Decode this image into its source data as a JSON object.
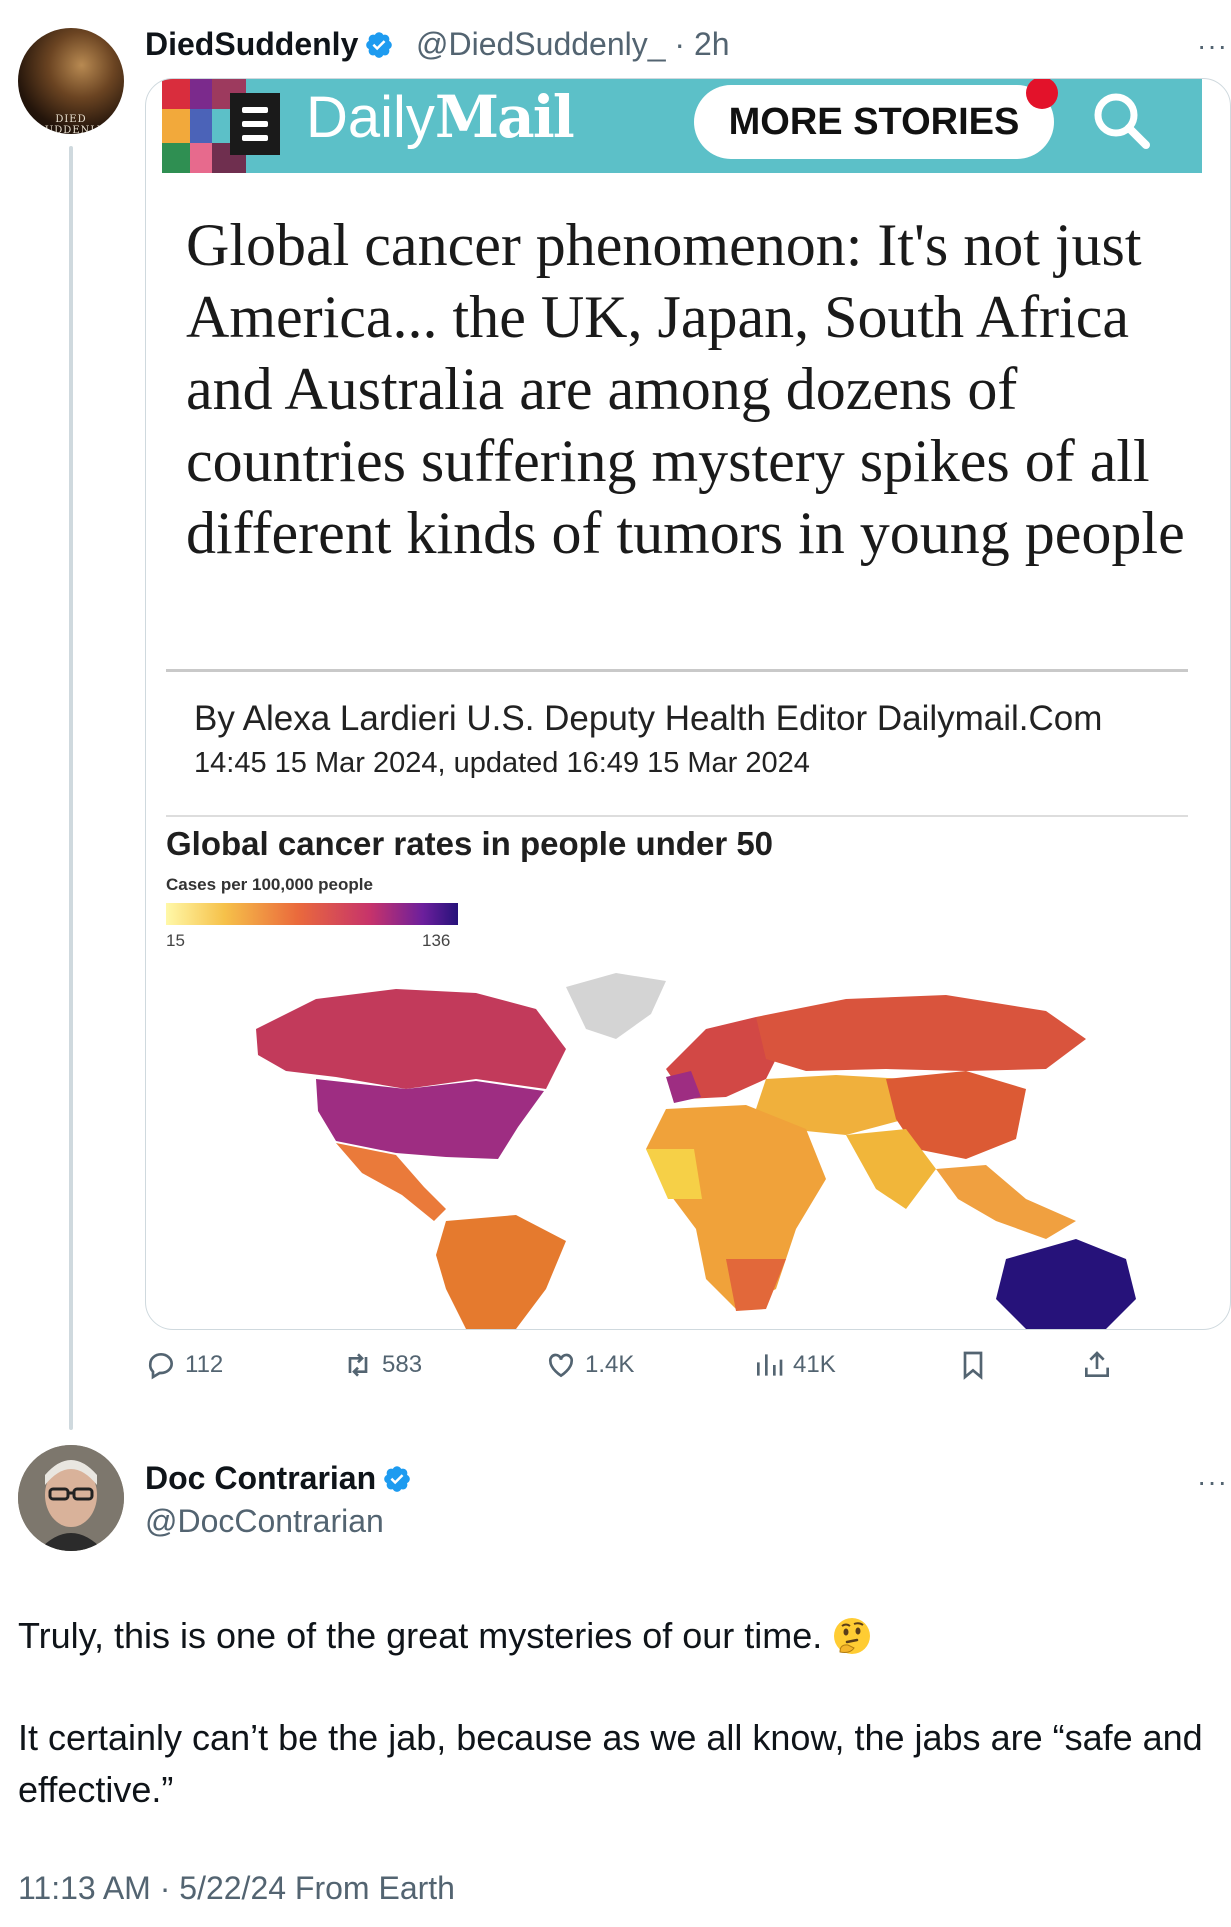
{
  "tweet1": {
    "display_name": "DiedSuddenly",
    "handle": "@DiedSuddenly_",
    "time": " · 2h",
    "avatar_text": "DIED SUDDENLY",
    "more": "···",
    "stats": {
      "replies": "112",
      "retweets": "583",
      "likes": "1.4K",
      "views": "41K"
    }
  },
  "article": {
    "logo_daily": "Daily",
    "logo_mail": "Mail",
    "more_stories": "MORE STORIES",
    "headline": "Global cancer phenomenon: It's not just America... the UK, Japan, South Africa and Australia are among dozens of countries suffering mystery spikes of all different kinds of tumors in young people",
    "byline": "By Alexa Lardieri U.S. Deputy Health Editor Dailymail.Com",
    "dateline": "14:45 15 Mar 2024, updated 16:49 15 Mar 2024",
    "map": {
      "title": "Global cancer rates in people under 50",
      "legend_label": "Cases per 100,000 people",
      "legend_min": "15",
      "legend_max": "136",
      "colors": {
        "low": "#fff8a8",
        "mid": "#ea6a3c",
        "high": "#26127a",
        "no_data": "#d4d4d4"
      }
    }
  },
  "tweet2": {
    "display_name": "Doc Contrarian",
    "handle": "@DocContrarian",
    "more": "···",
    "line1": "Truly, this is one of the great mysteries of our time.",
    "line2": "It certainly can’t be the jab, because as we all know, the jabs are “safe and effective.”",
    "timestamp": "11:13 AM · 5/22/24 From Earth"
  },
  "colors": {
    "verified": "#1d9bf0",
    "secondary_text": "#536471",
    "dm_bar": "#5cc0c8"
  }
}
